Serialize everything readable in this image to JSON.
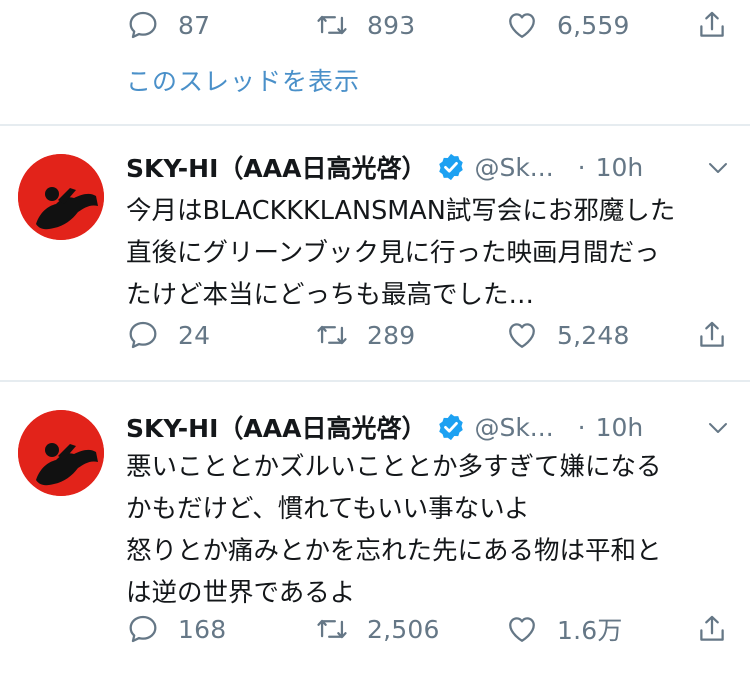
{
  "prev_tweet": {
    "replies": "87",
    "retweets": "893",
    "likes": "6,559",
    "show_thread": "このスレッドを表示"
  },
  "tweets": [
    {
      "name": "SKY-HI（AAA日高光啓）",
      "handle": "@Sk...",
      "dot": "·",
      "time": "10h",
      "lines": [
        "今月はBLACKKKLANSMAN試写会にお邪魔した",
        "直後にグリーンブック見に行った映画月間だっ",
        "たけど本当にどっちも最高でした…"
      ],
      "replies": "24",
      "retweets": "289",
      "likes": "5,248"
    },
    {
      "name": "SKY-HI（AAA日高光啓）",
      "handle": "@Sk...",
      "dot": "·",
      "time": "10h",
      "lines": [
        "悪いこととかズルいこととか多すぎて嫌になる",
        "かもだけど、慣れてもいい事ないよ",
        "怒りとか痛みとかを忘れた先にある物は平和と",
        "は逆の世界であるよ"
      ],
      "replies": "168",
      "retweets": "2,506",
      "likes": "1.6万"
    }
  ],
  "colors": {
    "accent": "#1da1f2",
    "link": "#4a90c9",
    "muted": "#657786",
    "avatar_bg": "#e2231a"
  },
  "icons": [
    "reply-icon",
    "retweet-icon",
    "like-icon",
    "share-icon",
    "verified-badge-icon",
    "chevron-down-icon"
  ]
}
